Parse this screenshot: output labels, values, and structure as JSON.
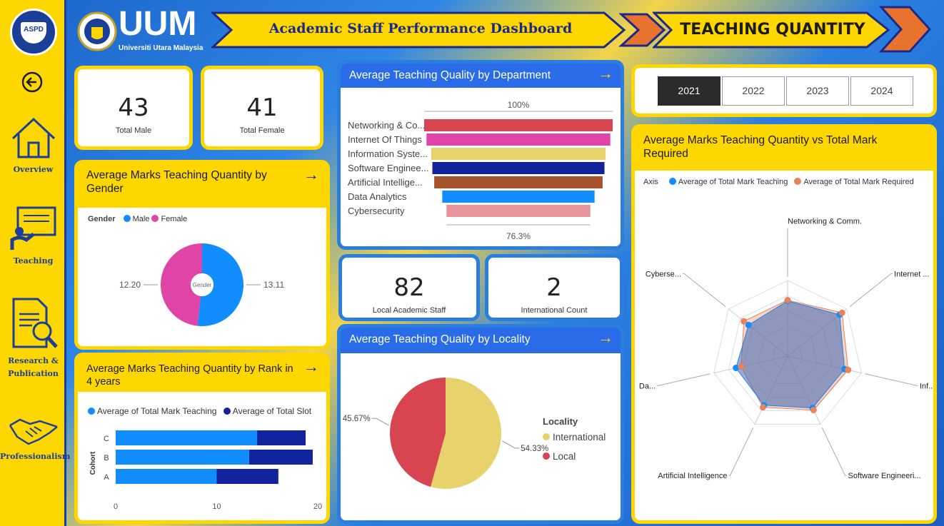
{
  "sidebar": {
    "logo_text": "ASPD",
    "items": [
      {
        "label": "Overview",
        "icon": "home-icon"
      },
      {
        "label": "Teaching",
        "icon": "teacher-board-icon"
      },
      {
        "label_line1": "Research &",
        "label_line2": "Publication",
        "icon": "document-search-icon"
      },
      {
        "label": "Professionalism",
        "icon": "handshake-icon"
      }
    ]
  },
  "header": {
    "uni_short": "UUM",
    "uni_full": "Universiti Utara Malaysia",
    "dashboard_title": "Academic Staff Performance Dashboard",
    "page_title": "TEACHING QUANTITY"
  },
  "kpis": {
    "male": {
      "value": "43",
      "label": "Total Male"
    },
    "female": {
      "value": "41",
      "label": "Total Female"
    },
    "local": {
      "value": "82",
      "label": "Local Academic Staff"
    },
    "international": {
      "value": "2",
      "label": "International Count"
    }
  },
  "years": [
    "2021",
    "2022",
    "2023",
    "2024"
  ],
  "selected_year": "2021",
  "colors": {
    "yellow": "#fed700",
    "blue": "#2a6ce8",
    "male": "#118dff",
    "female": "#e044a7",
    "teaching": "#118dff",
    "slot": "#12239e",
    "required": "#e8835a",
    "international": "#e8d26c",
    "local": "#d64550"
  },
  "charts": {
    "gender": {
      "title": "Average Marks Teaching Quantity by Gender",
      "legend_title": "Gender",
      "center_label": "Gender",
      "chart_data": {
        "type": "pie",
        "series": [
          {
            "name": "Male",
            "value": 13.11,
            "color": "#118dff"
          },
          {
            "name": "Female",
            "value": 12.2,
            "color": "#e044a7"
          }
        ]
      }
    },
    "rank": {
      "title": "Average Marks Teaching Quantity by Rank in 4 years",
      "axis_label": "Cohort",
      "chart_data": {
        "type": "bar",
        "categories": [
          "C",
          "B",
          "A"
        ],
        "series": [
          {
            "name": "Average of Total Mark Teaching",
            "values": [
              14,
              13.2,
              10
            ],
            "color": "#118dff"
          },
          {
            "name": "Average of Total Slot",
            "values": [
              4.8,
              6.3,
              6.1
            ],
            "color": "#12239e"
          }
        ],
        "xticks": [
          "0",
          "10",
          "20"
        ],
        "xlim": [
          0,
          20
        ]
      }
    },
    "department": {
      "title": "Average Teaching Quality by Department",
      "top_label": "100%",
      "bottom_label": "76.3%",
      "chart_data": {
        "type": "bar",
        "categories": [
          "Networking & Co...",
          "Internet Of Things",
          "Information Syste...",
          "Software Enginee...",
          "Artificial Intellige...",
          "Data Analytics",
          "Cybersecurity"
        ],
        "values": [
          100,
          97.5,
          92.5,
          91.3,
          89.3,
          80.8,
          76.3
        ],
        "colors": [
          "#d64550",
          "#e044a7",
          "#e8d26c",
          "#12239e",
          "#a6522c",
          "#118dff",
          "#e8929c"
        ]
      }
    },
    "locality": {
      "title": "Average Teaching Quality by Locality",
      "legend_title": "Locality",
      "chart_data": {
        "type": "pie",
        "series": [
          {
            "name": "International",
            "value": 54.33,
            "label": "54.33%",
            "color": "#e8d26c"
          },
          {
            "name": "Local",
            "value": 45.67,
            "label": "45.67%",
            "color": "#d64550"
          }
        ]
      }
    },
    "radar": {
      "title": "Average Marks Teaching Quantity vs Total Mark Required",
      "legend_title": "Axis",
      "chart_data": {
        "type": "radar",
        "axes": [
          "Networking & Comm.",
          "Internet ...",
          "Inf...",
          "Software Engineeri...",
          "Artificial Intelligence",
          "Da...",
          "Cyberse..."
        ],
        "series": [
          {
            "name": "Average of Total Mark Teaching",
            "values": [
              0.73,
              0.88,
              0.77,
              0.76,
              0.72,
              0.7,
              0.66
            ],
            "color": "#118dff"
          },
          {
            "name": "Average of Total Mark Required",
            "values": [
              0.74,
              0.92,
              0.82,
              0.79,
              0.75,
              0.63,
              0.74
            ],
            "color": "#e8835a"
          }
        ]
      }
    }
  }
}
